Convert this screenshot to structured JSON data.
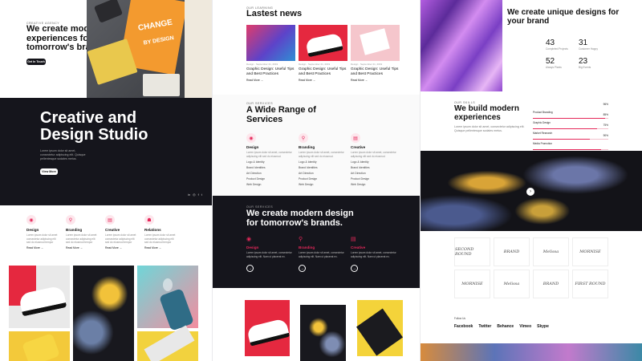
{
  "left": {
    "hero": {
      "eyebrow": "CREATIVE AGENCY",
      "title": "We create modern experiences for tomorrow's brands.",
      "button": "Get In Touch"
    },
    "dark": {
      "title": "Creative and Design Studio",
      "text": "Lorem ipsum dolor sit amet, consectetur adipiscing elit. Quisque pellentesque sodales metus.",
      "button": "View More",
      "socials": [
        "in",
        "◎",
        "f",
        "t"
      ]
    },
    "services": [
      {
        "label": "Design",
        "text": "Lorem ipsum dolor sit amet consectetur adipiscing elit sed do eiusmod tempor",
        "more": "Read More →"
      },
      {
        "label": "Branding",
        "text": "Lorem ipsum dolor sit amet consectetur adipiscing elit sed do eiusmod tempor",
        "more": "Read More →"
      },
      {
        "label": "Creative",
        "text": "Lorem ipsum dolor sit amet consectetur adipiscing elit sed do eiusmod tempor",
        "more": "Read More →"
      },
      {
        "label": "Relations",
        "text": "Lorem ipsum dolor sit amet consectetur adipiscing elit sed do eiusmod tempor",
        "more": "Read More →"
      }
    ]
  },
  "middle": {
    "news": {
      "eyebrow": "OUR LEARNING",
      "title": "Lastest news",
      "items": [
        {
          "meta": "Design · September 21, 2019",
          "title": "Graphic Design: Useful Tips and Best Practices",
          "more": "Read More →"
        },
        {
          "meta": "Design · September 21, 2019",
          "title": "Graphic Design: Useful Tips and Best Practices",
          "more": "Read More →"
        },
        {
          "meta": "Design · September 21, 2019",
          "title": "Graphic Design: Useful Tips and Best Practices",
          "more": "Read More →"
        }
      ]
    },
    "range": {
      "eyebrow": "OUR SERVICES",
      "title": "A Wide Range of Services",
      "cols": [
        {
          "label": "Design",
          "text": "Lorem ipsum dolor sit amet, consectetur adipiscing elit sed do eiusmod.",
          "items": [
            "Logo & Identity",
            "Brand Identities",
            "Art Direction",
            "Product Design",
            "Web Design"
          ]
        },
        {
          "label": "Branding",
          "text": "Lorem ipsum dolor sit amet, consectetur adipiscing elit sed do eiusmod.",
          "items": [
            "Logo & Identity",
            "Brand Identities",
            "Art Direction",
            "Product Design",
            "Web Design"
          ]
        },
        {
          "label": "Creative",
          "text": "Lorem ipsum dolor sit amet, consectetur adipiscing elit sed do eiusmod.",
          "items": [
            "Logo & Identity",
            "Brand Identities",
            "Art Direction",
            "Product Design",
            "Web Design"
          ]
        }
      ]
    },
    "dark": {
      "eyebrow": "OUR SERVICES",
      "title": "We create modern design for tomorrow's brands.",
      "cols": [
        {
          "label": "Design",
          "text": "Lorem ipsum dolor sit amet, consectetur adipiscing elit. Nam ut placerat ex."
        },
        {
          "label": "Branding",
          "text": "Lorem ipsum dolor sit amet, consectetur adipiscing elit. Nam ut placerat ex."
        },
        {
          "label": "Creative",
          "text": "Lorem ipsum dolor sit amet, consectetur adipiscing elit. Nam ut placerat ex."
        }
      ]
    }
  },
  "right": {
    "top": {
      "title": "We create unique designs for your brand",
      "stats": [
        {
          "n": "43",
          "l": "Completed Projects"
        },
        {
          "n": "31",
          "l": "Customer Happy"
        },
        {
          "n": "52",
          "l": "Always Plants"
        },
        {
          "n": "23",
          "l": "Big Events"
        }
      ]
    },
    "skills": {
      "eyebrow": "OUR SKILLS",
      "title": "We build modern experiences",
      "text": "Lorem ipsum dolor sit amet, consectetur adipiscing elit. Quisque pellentesque sodales metus.",
      "bars": [
        {
          "label": "Product Branding",
          "pct": "96%",
          "val": 0.96
        },
        {
          "label": "Graphic Design",
          "pct": "85%",
          "val": 0.85
        },
        {
          "label": "Market Research",
          "pct": "75%",
          "val": 0.75
        },
        {
          "label": "Media Promotion",
          "pct": "90%",
          "val": 0.9
        }
      ]
    },
    "logos": [
      "SECOND ROUND",
      "BRAND",
      "Melissa",
      "MORNISE",
      "MORNISE",
      "Melissa",
      "BRAND",
      "FIRST ROUND"
    ],
    "follow": {
      "label": "Follow Us",
      "links": [
        "Facebook",
        "Twitter",
        "Behance",
        "Vimeo",
        "Skype"
      ]
    }
  },
  "colors": {
    "accent": "#e5285a",
    "dark": "#15151c"
  }
}
